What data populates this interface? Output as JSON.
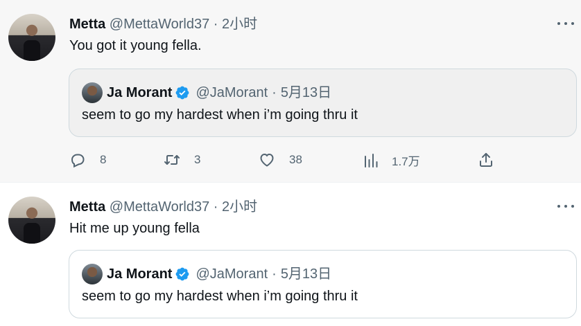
{
  "tweets": [
    {
      "author": {
        "name": "Metta",
        "handle": "@MettaWorld37"
      },
      "separator": "·",
      "time": "2小时",
      "text": "You got it young fella.",
      "quote": {
        "author": {
          "name": "Ja Morant",
          "handle": "@JaMorant"
        },
        "separator": "·",
        "date": "5月13日",
        "text": "seem to go my hardest when i’m going thru it"
      },
      "actions": {
        "replies": "8",
        "retweets": "3",
        "likes": "38",
        "views": "1.7万"
      }
    },
    {
      "author": {
        "name": "Metta",
        "handle": "@MettaWorld37"
      },
      "separator": "·",
      "time": "2小时",
      "text": "Hit me up young fella",
      "quote": {
        "author": {
          "name": "Ja Morant",
          "handle": "@JaMorant"
        },
        "separator": "·",
        "date": "5月13日",
        "text": "seem to go my hardest when i’m going thru it"
      }
    }
  ],
  "colors": {
    "verified": "#1d9bf0",
    "secondary_text": "#536471",
    "primary_text": "#0f1419",
    "border": "#cfd9de"
  }
}
